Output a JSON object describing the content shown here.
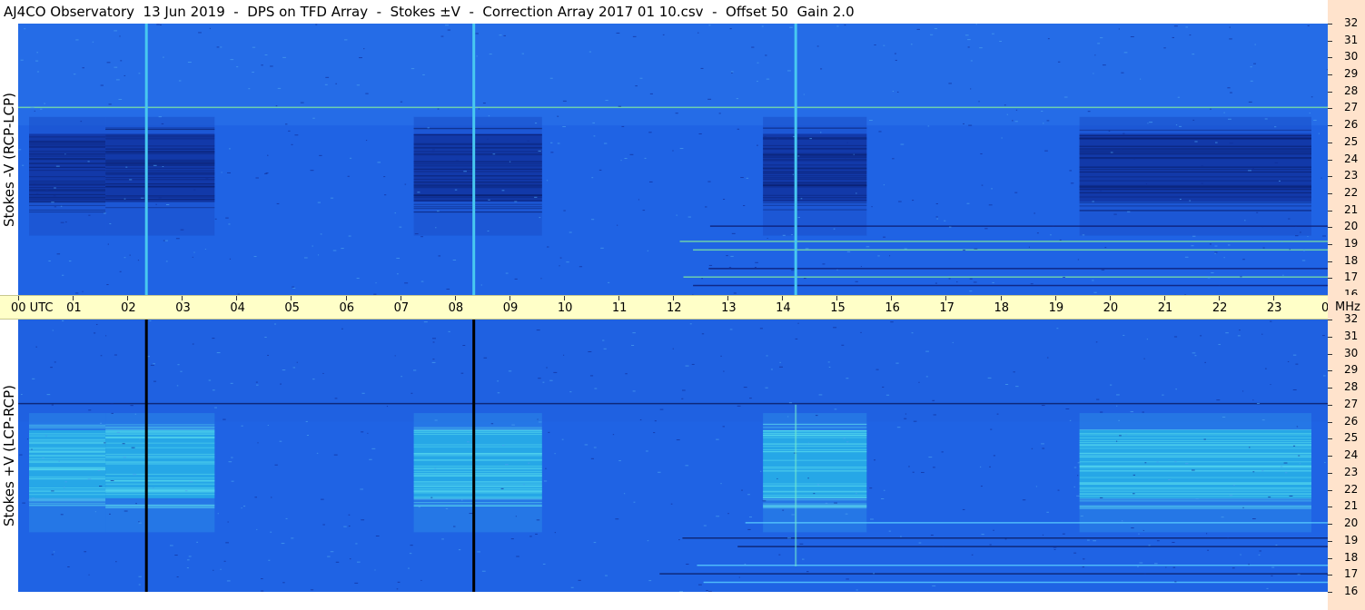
{
  "title": "AJ4CO Observatory  13 Jun 2019  -  DPS on TFD Array  -  Stokes ±V  -  Correction Array 2017 01 10.csv  -  Offset 50  Gain 2.0",
  "panels": {
    "top_label": "Stokes -V (RCP-LCP)",
    "bottom_label": "Stokes +V (LCP-RCP)"
  },
  "time_axis": {
    "labels": [
      "00 UTC",
      "01",
      "02",
      "03",
      "04",
      "05",
      "06",
      "07",
      "08",
      "09",
      "10",
      "11",
      "12",
      "13",
      "14",
      "15",
      "16",
      "17",
      "18",
      "19",
      "20",
      "21",
      "22",
      "23",
      "00"
    ],
    "unit_label": "MHz"
  },
  "freq_axis": {
    "labels": [
      "32",
      "31",
      "30",
      "29",
      "28",
      "27",
      "26",
      "25",
      "24",
      "23",
      "22",
      "21",
      "20",
      "19",
      "18",
      "17",
      "16"
    ]
  },
  "colors": {
    "background_blue": "#1f63e4",
    "dark_blue": "#0f2f9a",
    "light_blue": "#4aa0f0",
    "cyan": "#28d0e8",
    "axis_yellow": "#ffffc8",
    "axis_peach": "#ffe3cc"
  },
  "chart_data": {
    "type": "heatmap",
    "title": "AJ4CO Observatory  13 Jun 2019  -  DPS on TFD Array  -  Stokes ±V  -  Correction Array 2017 01 10.csv  -  Offset 50  Gain 2.0",
    "x_range_utc_hours": [
      0,
      24
    ],
    "y_range_mhz": [
      16,
      32
    ],
    "panels": [
      {
        "name": "Stokes -V (RCP-LCP)",
        "dark_time_blocks_utc": [
          [
            0.2,
            1.6
          ],
          [
            1.6,
            3.6
          ],
          [
            7.25,
            9.6
          ],
          [
            13.65,
            15.55
          ],
          [
            19.45,
            23.7
          ]
        ],
        "dark_freq_band_mhz": [
          21.5,
          25.5
        ],
        "bright_vertical_lines_utc": [
          2.35,
          8.35,
          14.25
        ]
      },
      {
        "name": "Stokes +V (LCP-RCP)",
        "bright_time_blocks_utc": [
          [
            0.2,
            1.6
          ],
          [
            1.6,
            3.6
          ],
          [
            7.25,
            9.6
          ],
          [
            13.65,
            15.55
          ],
          [
            19.45,
            23.7
          ]
        ],
        "bright_freq_band_mhz": [
          21.5,
          25.5
        ],
        "dark_vertical_lines_utc": [
          2.35,
          8.35
        ]
      }
    ]
  }
}
